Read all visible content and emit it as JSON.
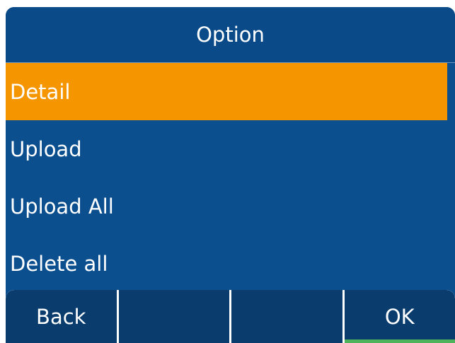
{
  "header": {
    "title": "Option"
  },
  "menu": {
    "items": [
      {
        "label": "Detail",
        "selected": true
      },
      {
        "label": "Upload",
        "selected": false
      },
      {
        "label": "Upload All",
        "selected": false
      },
      {
        "label": "Delete all",
        "selected": false
      }
    ]
  },
  "softkeys": {
    "keys": [
      {
        "label": "Back"
      },
      {
        "label": ""
      },
      {
        "label": ""
      },
      {
        "label": "OK"
      }
    ]
  },
  "colors": {
    "background": "#0c4f8f",
    "selection": "#f59500",
    "softkey": "#0a3d6e",
    "ok_indicator": "#4fb35b"
  }
}
